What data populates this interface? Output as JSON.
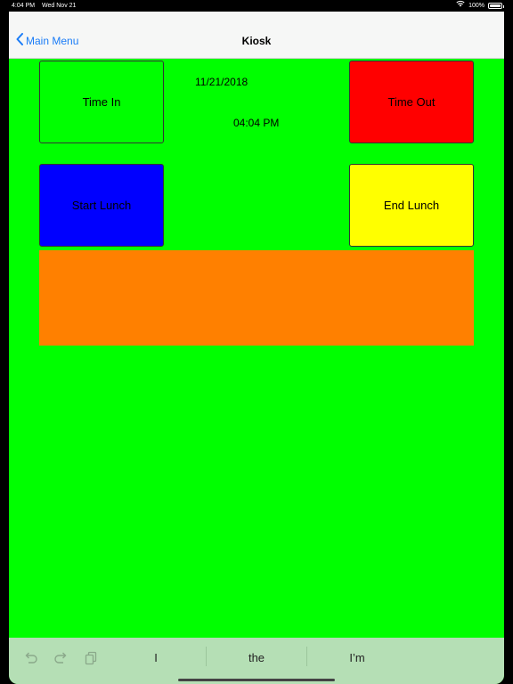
{
  "status_bar": {
    "time": "4:04 PM",
    "date": "Wed Nov 21",
    "battery": "100%",
    "icons": [
      "wifi-icon",
      "battery-icon"
    ]
  },
  "nav": {
    "back_label": "Main Menu",
    "title": "Kiosk"
  },
  "kiosk": {
    "time_in_label": "Time In",
    "time_out_label": "Time Out",
    "start_lunch_label": "Start Lunch",
    "end_lunch_label": "End Lunch",
    "date": "11/21/2018",
    "time": "04:04 PM",
    "message": ""
  },
  "keyboard_bar": {
    "icons": [
      "undo-icon",
      "redo-icon",
      "paste-icon"
    ],
    "suggestions": [
      "I",
      "the",
      "I’m"
    ]
  },
  "colors": {
    "background": "#00ff00",
    "time_in": "#00ff00",
    "time_out": "#ff0000",
    "start_lunch": "#0000ff",
    "end_lunch": "#ffff00",
    "message_panel": "#ff8000",
    "nav_accent": "#1a7cf7"
  }
}
